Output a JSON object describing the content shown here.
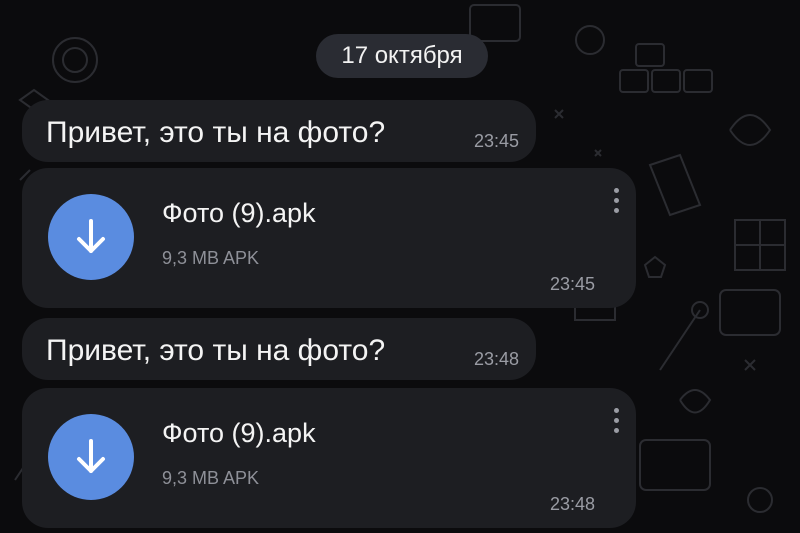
{
  "colors": {
    "background": "#0b0b0d",
    "bubble": "#1d1e22",
    "date_chip": "#2a2c33",
    "accent": "#5a8ce0",
    "timestamp": "#9a9ca4"
  },
  "chat": {
    "date_separator": "17 октября",
    "messages": [
      {
        "type": "text",
        "text": "Привет, это ты на фото?",
        "time": "23:45"
      },
      {
        "type": "file",
        "file_name": "Фото (9).apk",
        "file_meta": "9,3 MB APK",
        "time": "23:45",
        "icon": "download-arrow-icon",
        "menu_icon": "more-vertical-icon"
      },
      {
        "type": "text",
        "text": "Привет, это ты на фото?",
        "time": "23:48"
      },
      {
        "type": "file",
        "file_name": "Фото (9).apk",
        "file_meta": "9,3 MB APK",
        "time": "23:48",
        "icon": "download-arrow-icon",
        "menu_icon": "more-vertical-icon"
      }
    ]
  }
}
